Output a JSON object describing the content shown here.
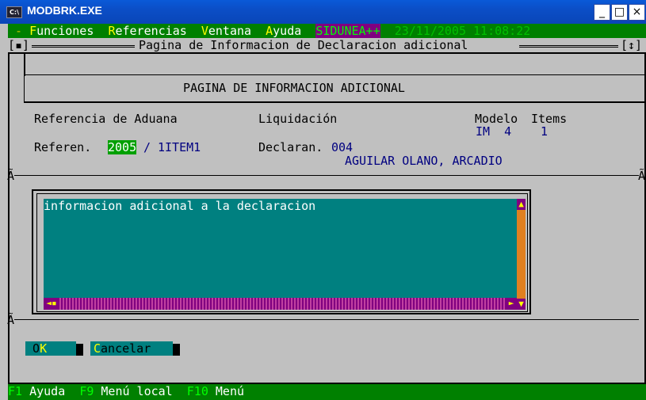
{
  "window": {
    "title": "MODBRK.EXE",
    "icon_label": "C:\\",
    "min_glyph": "_",
    "max_glyph": "□",
    "close_glyph": "×"
  },
  "menu": {
    "lead": " - ",
    "items": [
      {
        "hot": "F",
        "rest": "unciones"
      },
      {
        "hot": "R",
        "rest": "eferencias"
      },
      {
        "hot": "V",
        "rest": "entana"
      },
      {
        "hot": "A",
        "rest": "yuda"
      }
    ],
    "sidunea": "SIDUNEA++",
    "datetime": "23/11/2005 11:08:22"
  },
  "frame": {
    "left_marker": "[▪]",
    "title": "Pagina de Informacion de Declaracion adicional",
    "right_marker": "[↕]"
  },
  "header": {
    "title": "PAGINA DE INFORMACION ADICIONAL"
  },
  "info": {
    "ref_aduana_label": "Referencia de Aduana",
    "liquidacion_label": "Liquidación",
    "modelo_label": "Modelo",
    "items_label": "Items",
    "modelo_value": "IM  4",
    "items_value": "1",
    "referen_label": "Referen.",
    "referen_year": "2005",
    "referen_sep": "/",
    "referen_code": "1ITEM1",
    "declaran_label": "Declaran.",
    "declaran_code": "004",
    "declaran_name": "AGUILAR OLANO, ARCADIO",
    "side_glyph": "Ã"
  },
  "text": {
    "content": "informacion adicional a la declaracion"
  },
  "buttons": {
    "ok_pre": " O",
    "ok_hot": "K",
    "ok_post": " ",
    "cancel_hot": "C",
    "cancel_rest": "ancelar"
  },
  "status": {
    "items": [
      {
        "key": "F1",
        "label": "Ayuda"
      },
      {
        "key": "F9",
        "label": "Menú local"
      },
      {
        "key": "F10",
        "label": "Menú"
      }
    ]
  },
  "colors": {
    "menu_bg": "#008000",
    "text_area_bg": "#008080",
    "console_bg": "#c0c0c0",
    "accent_purple": "#800080"
  }
}
